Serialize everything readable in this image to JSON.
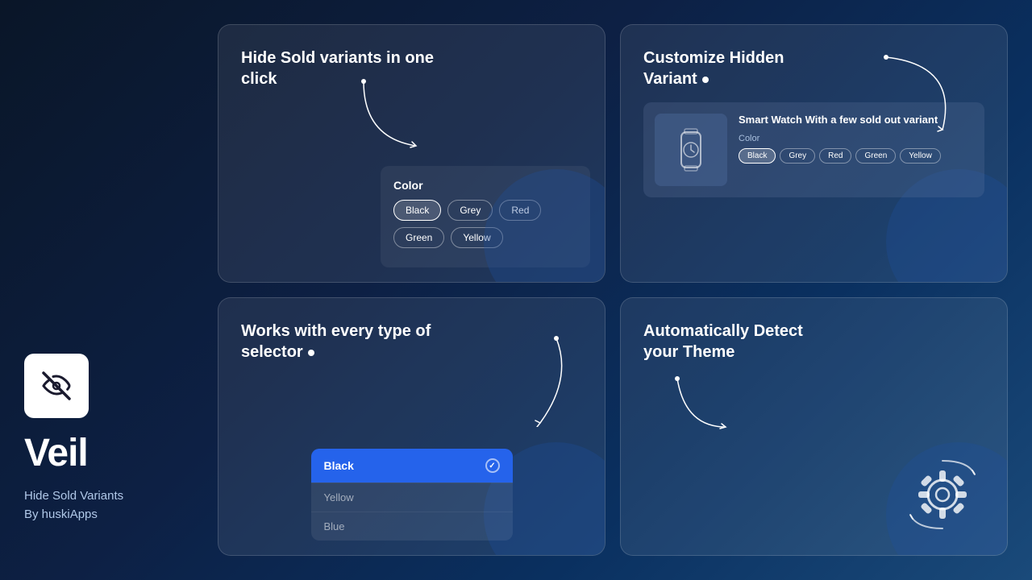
{
  "brand": {
    "name": "Veil",
    "tagline_line1": "Hide Sold Variants",
    "tagline_line2": "By huskiApps"
  },
  "card1": {
    "title": "Hide Sold variants in one click",
    "color_label": "Color",
    "colors": [
      "Black",
      "Grey",
      "Red",
      "Green",
      "Yellow"
    ]
  },
  "card2": {
    "title": "Customize Hidden Variant",
    "product_title": "Smart Watch With a few sold out variant",
    "color_label": "Color",
    "colors": [
      "Black",
      "Grey",
      "Red",
      "Green",
      "Yellow"
    ]
  },
  "card3": {
    "title": "Works with every type of selector",
    "dropdown_selected": "Black",
    "dropdown_options": [
      "Yellow",
      "Blue"
    ]
  },
  "card4": {
    "title": "Automatically Detect your Theme"
  }
}
